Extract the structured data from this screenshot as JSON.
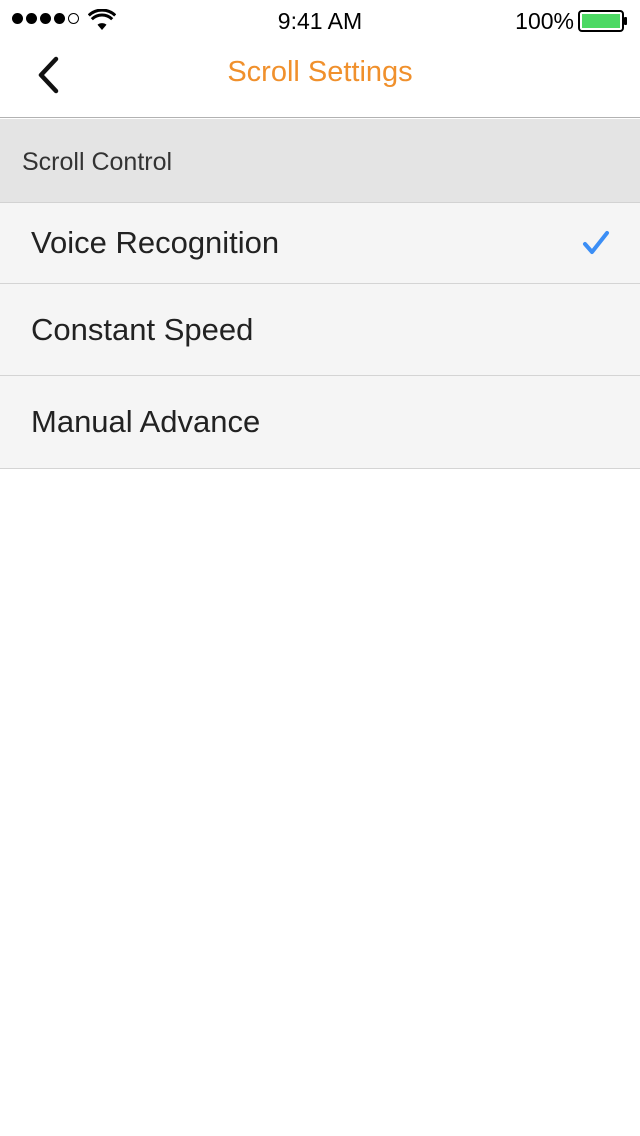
{
  "status_bar": {
    "time": "9:41 AM",
    "battery_percent": "100%",
    "signal_strength_bars": 4,
    "signal_total_bars": 5,
    "battery_level": 1.0,
    "battery_color": "#4cd964"
  },
  "nav": {
    "back_icon": "chevron-left-icon",
    "title": "Scroll Settings",
    "title_color": "#f0902c"
  },
  "section": {
    "header": "Scroll Control"
  },
  "options": [
    {
      "label": "Voice Recognition",
      "selected": true
    },
    {
      "label": "Constant Speed",
      "selected": false
    },
    {
      "label": "Manual Advance",
      "selected": false
    }
  ],
  "colors": {
    "check_color": "#3b8ef5",
    "row_background": "#f5f5f5",
    "section_background": "#e4e4e4"
  }
}
